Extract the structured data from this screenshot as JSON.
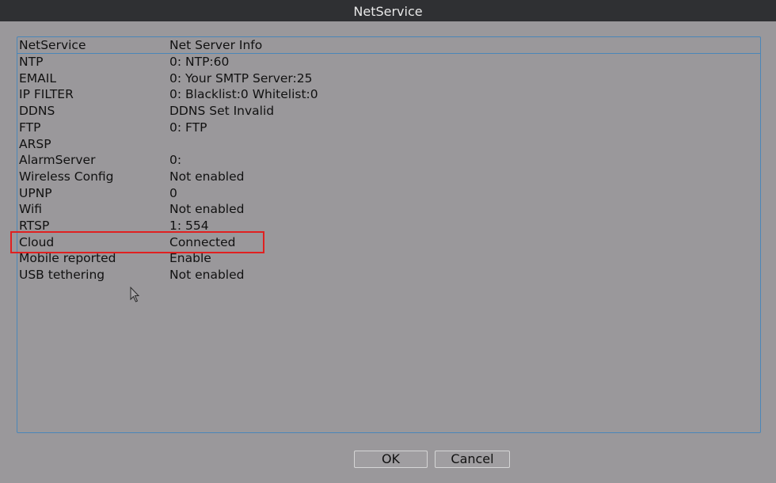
{
  "window": {
    "title": "NetService"
  },
  "table": {
    "headers": {
      "name": "NetService",
      "info": "Net Server Info"
    },
    "rows": [
      {
        "name": "NTP",
        "info": "0: NTP:60"
      },
      {
        "name": "EMAIL",
        "info": "0: Your SMTP Server:25"
      },
      {
        "name": "IP FILTER",
        "info": "0: Blacklist:0 Whitelist:0"
      },
      {
        "name": "DDNS",
        "info": "DDNS Set Invalid"
      },
      {
        "name": "FTP",
        "info": "0: FTP"
      },
      {
        "name": "ARSP",
        "info": ""
      },
      {
        "name": "AlarmServer",
        "info": "0:"
      },
      {
        "name": "Wireless Config",
        "info": "Not enabled"
      },
      {
        "name": "UPNP",
        "info": "0"
      },
      {
        "name": "Wifi",
        "info": "Not enabled"
      },
      {
        "name": "RTSP",
        "info": "1: 554"
      },
      {
        "name": "Cloud",
        "info": "Connected"
      },
      {
        "name": "Mobile reported",
        "info": "Enable"
      },
      {
        "name": "USB tethering",
        "info": "Not enabled"
      }
    ]
  },
  "buttons": {
    "ok": "OK",
    "cancel": "Cancel"
  },
  "colors": {
    "background": "#9a989b",
    "titlebar": "#2f3033",
    "panel_border": "#4a86b8",
    "highlight": "#e02020"
  },
  "icons": {
    "cursor": "mouse-pointer-icon"
  }
}
